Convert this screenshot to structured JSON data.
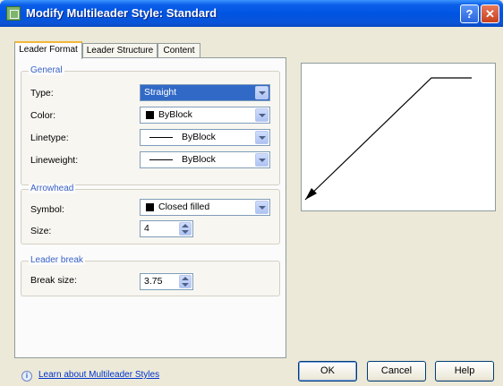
{
  "window": {
    "title": "Modify Multileader Style: Standard",
    "help_label": "?",
    "close_label": "✕"
  },
  "tabs": [
    {
      "label": "Leader Format",
      "active": true
    },
    {
      "label": "Leader Structure",
      "active": false
    },
    {
      "label": "Content",
      "active": false
    }
  ],
  "general": {
    "title": "General",
    "type": {
      "label": "Type:",
      "value": "Straight"
    },
    "color": {
      "label": "Color:",
      "value": "ByBlock"
    },
    "linetype": {
      "label": "Linetype:",
      "value": "ByBlock"
    },
    "lineweight": {
      "label": "Lineweight:",
      "value": "ByBlock"
    }
  },
  "arrowhead": {
    "title": "Arrowhead",
    "symbol": {
      "label": "Symbol:",
      "value": "Closed filled"
    },
    "size": {
      "label": "Size:",
      "value": "4"
    }
  },
  "leader_break": {
    "title": "Leader break",
    "break_size": {
      "label": "Break size:",
      "value": "3.75"
    }
  },
  "footer": {
    "learn_link": "Learn about Multileader Styles",
    "ok_label": "OK",
    "cancel_label": "Cancel",
    "help_label": "Help"
  },
  "colors": {
    "titlebar": "#0054e3",
    "accent_tab": "#f3b739",
    "selection": "#3169c6"
  },
  "icons": [
    "app-icon",
    "help-icon",
    "close-icon",
    "dropdown-arrow-icon",
    "spinner-icon",
    "info-icon",
    "leader-arrow-icon"
  ]
}
